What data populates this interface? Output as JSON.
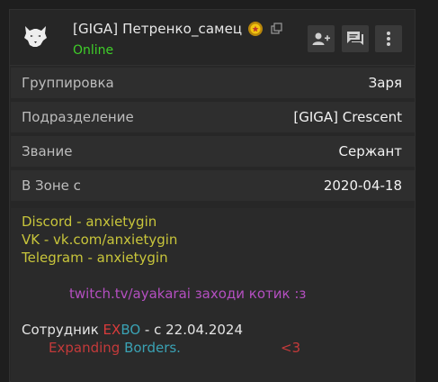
{
  "header": {
    "username": "[GIGA] Петренко_самец",
    "status": "Online",
    "status_color": "#3fcf29",
    "badge_icon": "gold-medal-icon",
    "copy_icon": "copy-icon",
    "actions": [
      {
        "icon": "add-friend-icon"
      },
      {
        "icon": "message-icon"
      },
      {
        "icon": "more-options-icon"
      }
    ]
  },
  "info": {
    "rows": [
      {
        "label": "Группировка",
        "value": "Заря"
      },
      {
        "label": "Подразделение",
        "value": "[GIGA] Crescent"
      },
      {
        "label": "Звание",
        "value": "Сержант"
      },
      {
        "label": "В Зоне с",
        "value": "2020-04-18"
      }
    ]
  },
  "bio": {
    "discord": "Discord - anxietygin",
    "vk": "VK - vk.com/anxietygin",
    "telegram": "Telegram - anxietygin",
    "twitch": "twitch.tv/ayakarai заходи котик :з",
    "employee_prefix": "Сотрудник ",
    "employee_ex": "EX",
    "employee_bo": "BO",
    "employee_suffix": " - с 22.04.2024",
    "expanding": "Expanding",
    "borders": "Borders.",
    "heart": "<3"
  }
}
